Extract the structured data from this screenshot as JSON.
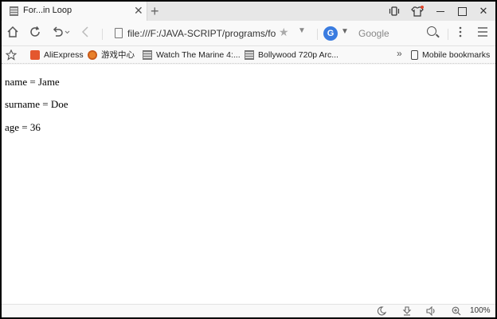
{
  "tab": {
    "title": "For...in Loop",
    "close_glyph": "✕",
    "new_tab_glyph": "+",
    "favicon": "document-icon"
  },
  "window_controls": {
    "close_glyph": "✕",
    "icons": [
      "vibrate-icon",
      "shirt-icon",
      "minimize-icon",
      "maximize-icon",
      "close-icon"
    ]
  },
  "toolbar": {
    "home_icon": "home-icon",
    "reload_icon": "reload-icon",
    "undo_icon": "undo-icon",
    "back_icon": "back-arrow-icon",
    "menu_icon": "hamburger-menu-icon"
  },
  "address_bar": {
    "url": "file:///F:/JAVA-SCRIPT/programs/for.",
    "bookmark_star": "star-icon"
  },
  "search": {
    "engine_letter": "G",
    "placeholder": "Google"
  },
  "bookmarks": {
    "items": [
      {
        "label": "AliExpress",
        "icon": "aliexpress-icon"
      },
      {
        "label": "游戏中心",
        "icon": "game-center-icon"
      },
      {
        "label": "Watch The Marine 4:...",
        "icon": "document-icon"
      },
      {
        "label": "Bollywood 720p Arc...",
        "icon": "document-icon"
      }
    ],
    "more": "»",
    "mobile": "Mobile bookmarks"
  },
  "content": {
    "lines": [
      "name = Jame",
      "surname = Doe",
      "age = 36"
    ]
  },
  "status": {
    "zoom": "100%",
    "icons": [
      "night-mode-icon",
      "download-icon",
      "sound-icon",
      "zoom-icon"
    ]
  },
  "colors": {
    "window_bg": "#f9f9f9",
    "tab_strip": "#e7e7e7",
    "notification_dot": "#e0452b",
    "search_engine": "#3a7ce0"
  }
}
